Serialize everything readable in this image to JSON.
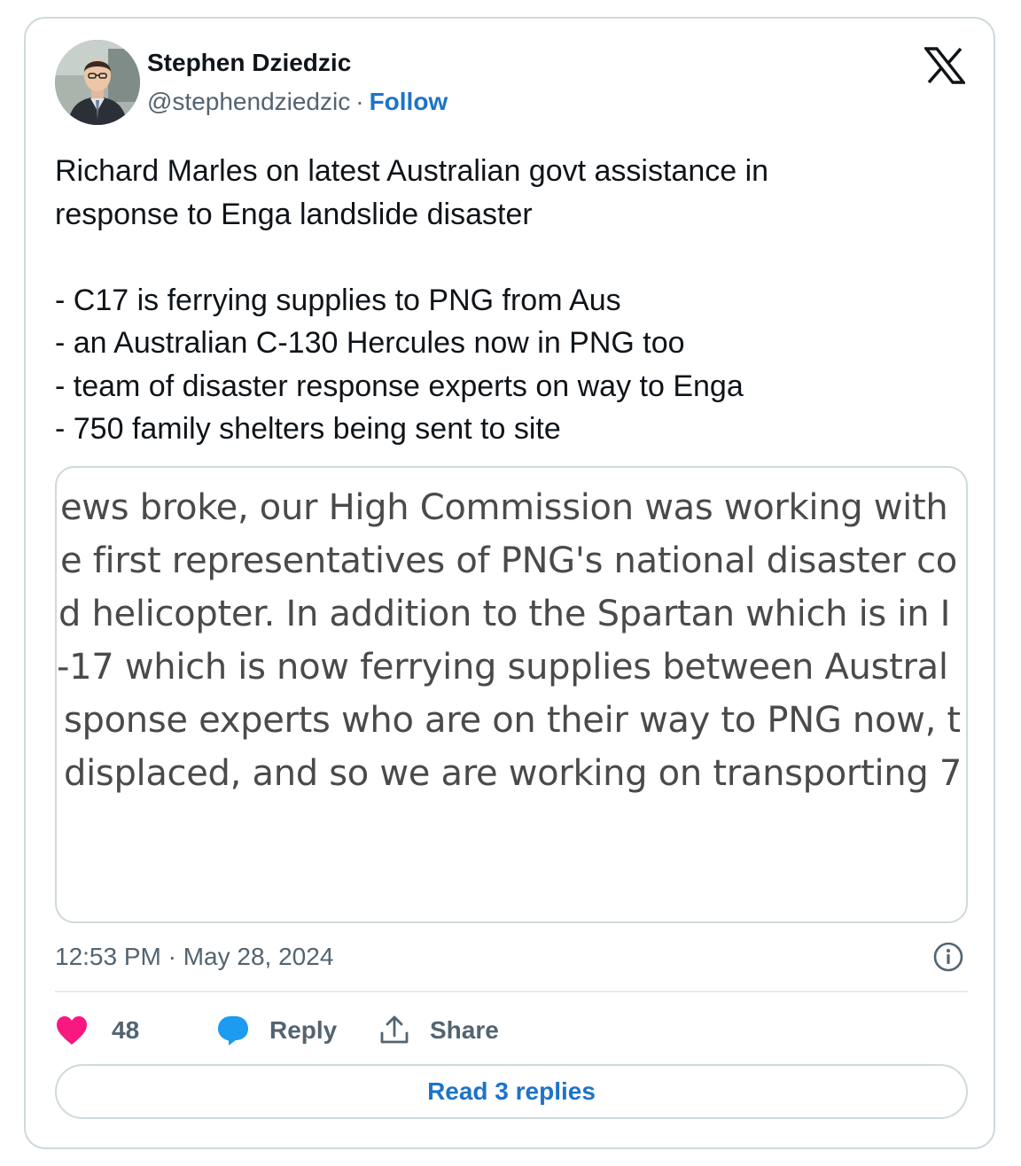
{
  "author": {
    "name": "Stephen Dziedzic",
    "handle": "@stephendziedzic",
    "separator": "·",
    "follow_label": "Follow"
  },
  "tweet": {
    "lines": [
      "Richard Marles on latest Australian govt assistance in",
      "response to Enga landslide disaster",
      "- C17 is ferrying supplies to PNG from Aus",
      "- an Australian C-130 Hercules now in PNG too",
      "- team of disaster response experts on way to Enga",
      "- 750 family shelters being sent to site"
    ]
  },
  "media": {
    "lines": [
      "ews broke, our High Commission was working with",
      "e first representatives of PNG's national disaster co",
      "d helicopter. In addition to the Spartan which is in I",
      "-17 which is now ferrying supplies between Austral",
      "sponse experts who are on their way to PNG now, t",
      "displaced, and so we are working on transporting 7"
    ]
  },
  "timestamp": "12:53 PM · May 28, 2024",
  "actions": {
    "like_count": "48",
    "reply_label": "Reply",
    "share_label": "Share"
  },
  "read_replies_label": "Read 3 replies",
  "icons": {
    "like": "heart-icon",
    "reply": "speech-bubble-icon",
    "share": "share-arrow-icon",
    "info": "info-icon",
    "logo": "x-logo-icon"
  },
  "colors": {
    "like": "#f91880",
    "reply": "#1d9bf0",
    "link": "#1d73c8",
    "border": "#cfd9de",
    "muted": "#536471"
  }
}
